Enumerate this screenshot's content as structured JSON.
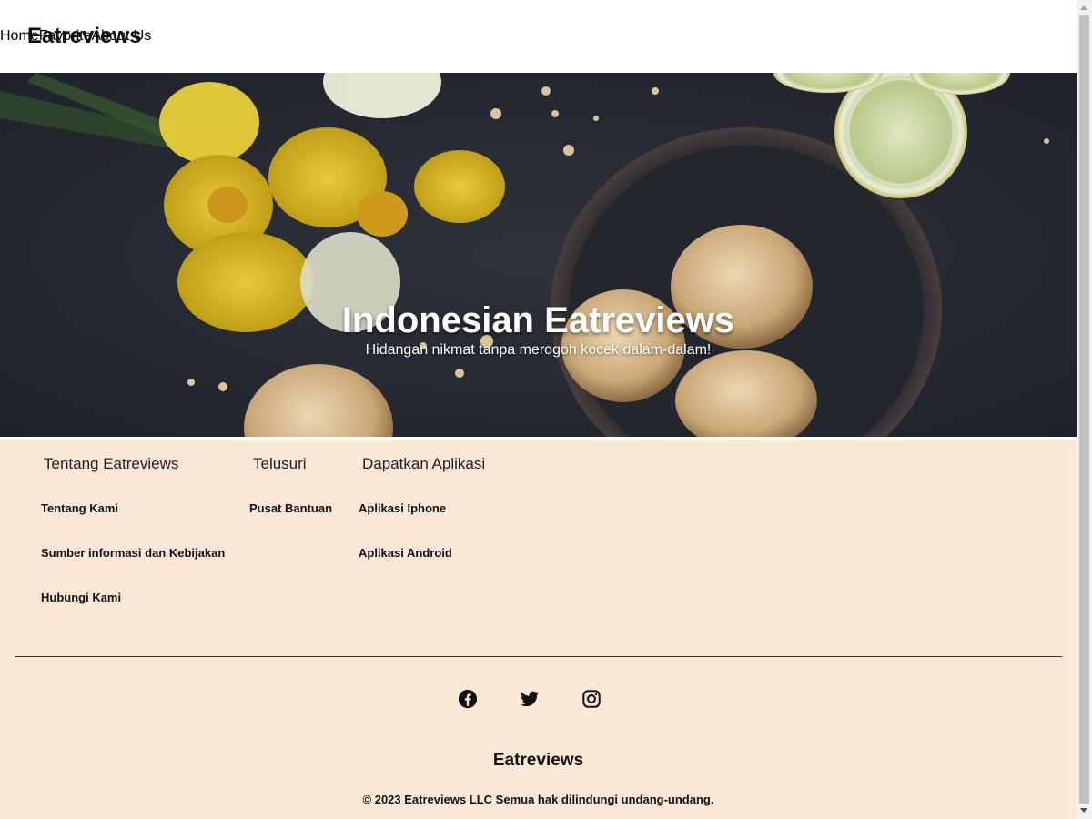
{
  "header": {
    "brand": "Eatreviews",
    "nav": [
      "Home",
      "Favorite",
      "About Us"
    ]
  },
  "hero": {
    "title": "Indonesian Eatreviews",
    "subtitle": "Hidangan nikmat tanpa merogoh kocek dalam-dalam!"
  },
  "footer": {
    "columns": [
      {
        "title": "Tentang Eatreviews",
        "links": [
          "Tentang Kami",
          "Sumber informasi dan Kebijakan",
          "Hubungi Kami"
        ]
      },
      {
        "title": "Telusuri",
        "links": [
          "Pusat Bantuan"
        ]
      },
      {
        "title": "Dapatkan Aplikasi",
        "links": [
          "Aplikasi Iphone",
          "Aplikasi Android"
        ]
      }
    ],
    "social_icons": [
      "facebook-icon",
      "twitter-icon",
      "instagram-icon"
    ],
    "brand": "Eatreviews",
    "copyright": "© 2023 Eatreviews LLC Semua hak dilindungi undang-undang."
  },
  "colors": {
    "footer_bg": "#f9e8d6",
    "hero_bg": "#262a33",
    "text": "#111111"
  }
}
